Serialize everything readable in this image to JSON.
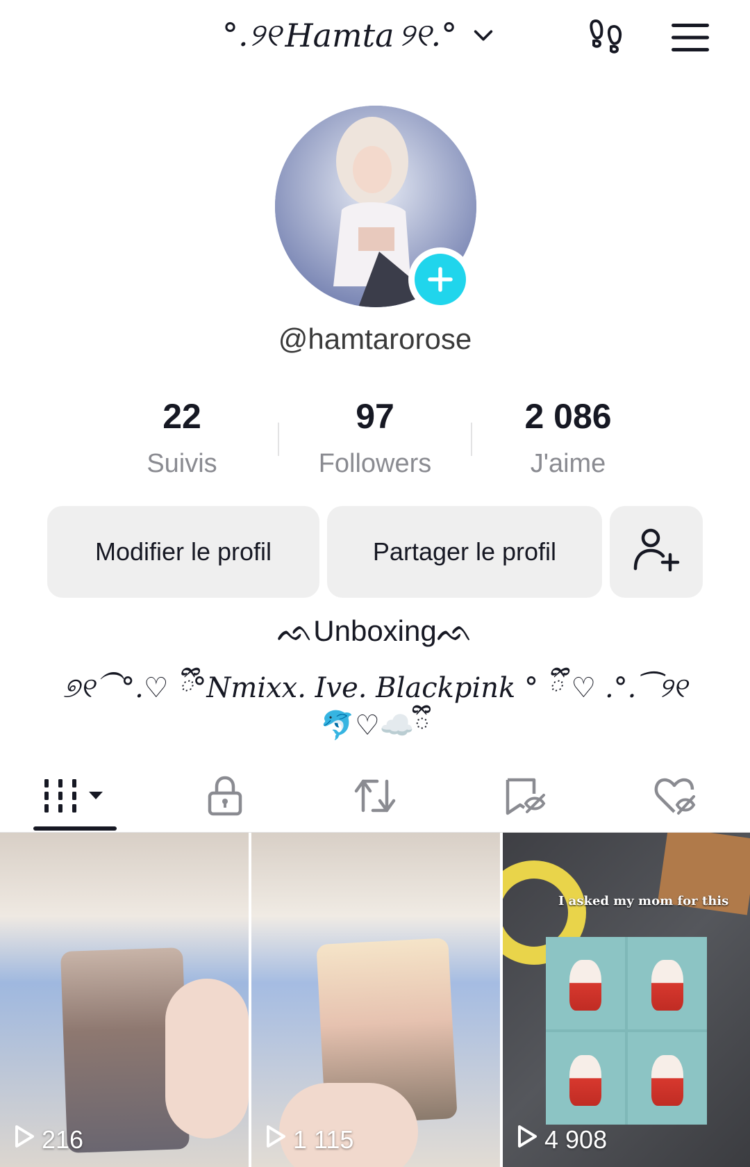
{
  "header": {
    "display_name": "Hamta",
    "deco_left": "°.୨୧",
    "deco_right": "୨୧.°",
    "icons": [
      "chevron-down-icon",
      "footprints-icon",
      "menu-icon"
    ]
  },
  "profile": {
    "handle": "@hamtarorose",
    "accent_color": "#20d5ec"
  },
  "stats": [
    {
      "value": "22",
      "label": "Suivis"
    },
    {
      "value": "97",
      "label": "Followers"
    },
    {
      "value": "2 086",
      "label": "J'aime"
    }
  ],
  "buttons": {
    "edit": "Modifier le profil",
    "share": "Partager le profil"
  },
  "bio": {
    "line1": "ᨒUnboxingᨒ",
    "line2": "୭୧⁀°.♡ ྀི°Nmixx. Ive. Blackpink ° ྀི ♡ .°.⁀୨୧",
    "line3": "🐬♡☁️ྀི"
  },
  "tabs": [
    "videos-tab",
    "private-tab",
    "reposts-tab",
    "favorites-tab",
    "liked-tab"
  ],
  "videos": [
    {
      "views": "216"
    },
    {
      "views": "1 115"
    },
    {
      "views": "4 908",
      "caption": "I asked my mom for this"
    }
  ]
}
